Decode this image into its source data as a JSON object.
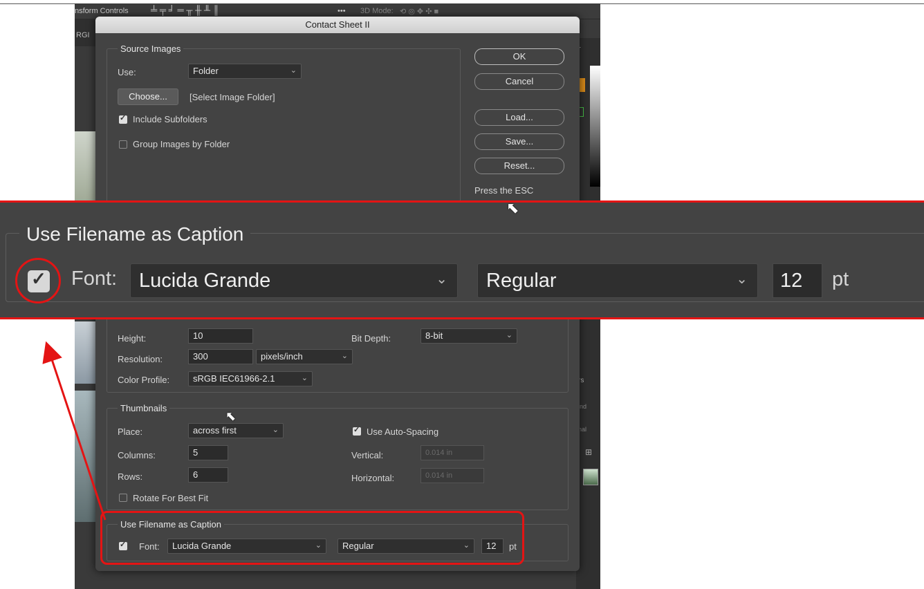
{
  "toolbar": {
    "transform_controls": "nsform Controls",
    "more": "•••",
    "mode3d": "3D Mode:"
  },
  "ps_side": {
    "tab_label": "RGI",
    "panel_r": "r",
    "panel_rs": "rs",
    "panel_ind": "ind",
    "panel_nal": "nal"
  },
  "dialog": {
    "title": "Contact Sheet II",
    "source": {
      "title": "Source Images",
      "use_label": "Use:",
      "use_value": "Folder",
      "choose_label": "Choose...",
      "folder_text": "[Select Image Folder]",
      "include_subfolders": "Include Subfolders",
      "group_by_folder": "Group Images by Folder"
    },
    "buttons": {
      "ok": "OK",
      "cancel": "Cancel",
      "load": "Load...",
      "save": "Save...",
      "reset": "Reset...",
      "hint": "Press the ESC"
    },
    "document": {
      "height_label": "Height:",
      "height_value": "10",
      "bitdepth_label": "Bit Depth:",
      "bitdepth_value": "8-bit",
      "resolution_label": "Resolution:",
      "resolution_value": "300",
      "resolution_unit": "pixels/inch",
      "profile_label": "Color Profile:",
      "profile_value": "sRGB IEC61966-2.1"
    },
    "thumbnails": {
      "title": "Thumbnails",
      "place_label": "Place:",
      "place_value": "across first",
      "auto_spacing": "Use Auto-Spacing",
      "columns_label": "Columns:",
      "columns_value": "5",
      "vertical_label": "Vertical:",
      "vertical_value": "0.014 in",
      "rows_label": "Rows:",
      "rows_value": "6",
      "horizontal_label": "Horizontal:",
      "horizontal_value": "0.014 in",
      "rotate": "Rotate For Best Fit"
    },
    "caption": {
      "title": "Use Filename as Caption",
      "font_label": "Font:",
      "font_value": "Lucida Grande",
      "style_value": "Regular",
      "size_value": "12",
      "size_unit": "pt"
    }
  },
  "zoom": {
    "title": "Use Filename as Caption",
    "font_label": "Font:",
    "font_value": "Lucida Grande",
    "style_value": "Regular",
    "size_value": "12",
    "size_unit": "pt"
  },
  "colors": {
    "highlight": "#e41414",
    "dialog_bg": "#434343"
  }
}
